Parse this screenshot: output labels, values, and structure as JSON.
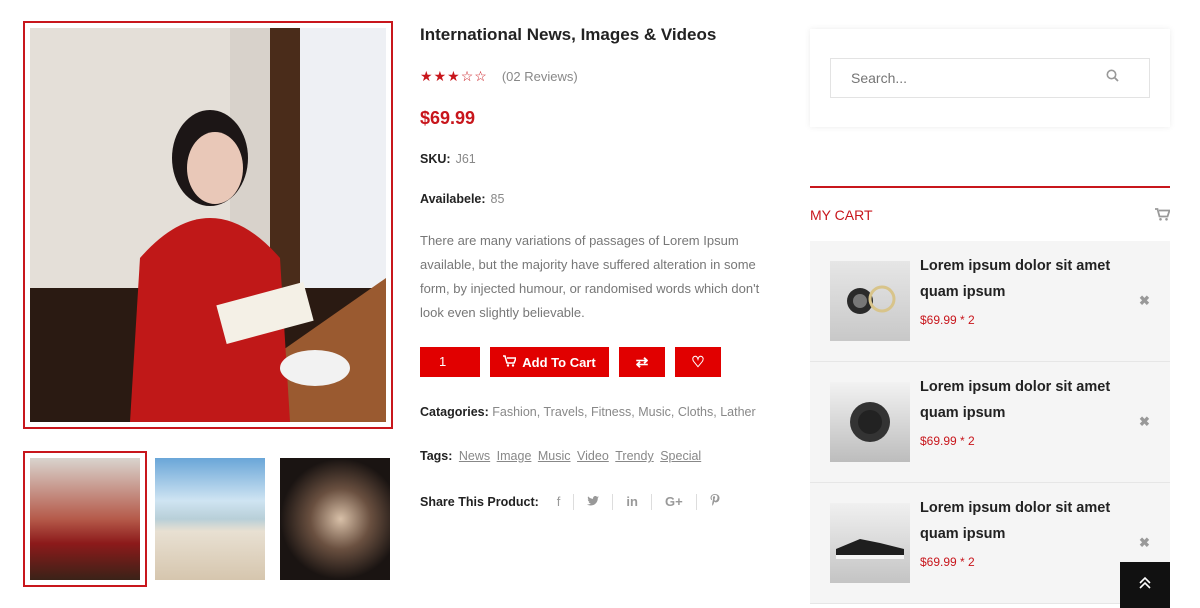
{
  "product": {
    "title": "International News, Images & Videos",
    "stars_filled": 3,
    "stars_total": 5,
    "reviews": "(02 Reviews)",
    "price": "$69.99",
    "sku_label": "SKU:",
    "sku_value": "J61",
    "available_label": "Availabele:",
    "available_value": "85",
    "description": "There are many variations of passages of Lorem Ipsum available, but the majority have suffered alteration in some form, by injected humour, or randomised words which don't look even slightly believable.",
    "quantity": "1",
    "add_to_cart_label": "Add To Cart",
    "categories_label": "Catagories:",
    "categories": [
      "Fashion",
      "Travels",
      "Fitness",
      "Music",
      "Cloths",
      "Lather"
    ],
    "tags_label": "Tags:",
    "tags": [
      "News",
      "Image",
      "Music",
      "Video",
      "Trendy",
      "Special"
    ],
    "share_label": "Share This Product:"
  },
  "search": {
    "placeholder": "Search..."
  },
  "cart": {
    "title": "MY CART",
    "items": [
      {
        "name": "Lorem ipsum dolor sit amet quam ipsum",
        "price": "$69.99 * 2",
        "image": "camera-lens"
      },
      {
        "name": "Lorem ipsum dolor sit amet quam ipsum",
        "price": "$69.99 * 2",
        "image": "hat"
      },
      {
        "name": "Lorem ipsum dolor sit amet quam ipsum",
        "price": "$69.99 * 2",
        "image": "sneaker"
      }
    ]
  },
  "colors": {
    "accent": "#e10000",
    "accent_dark": "#c8161c",
    "muted_text": "#888888"
  }
}
